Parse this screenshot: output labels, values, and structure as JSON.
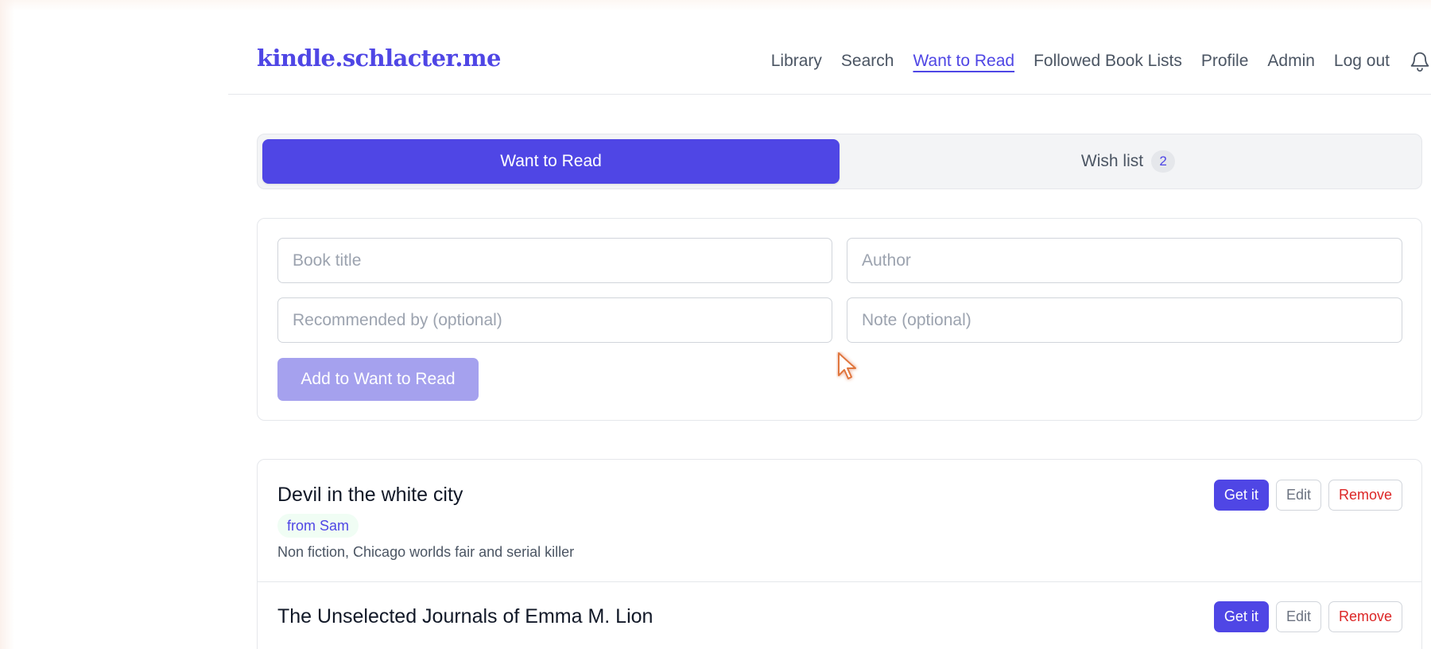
{
  "header": {
    "brand": "kindle.schlacter.me",
    "nav": [
      {
        "label": "Library"
      },
      {
        "label": "Search"
      },
      {
        "label": "Want to Read",
        "active": true
      },
      {
        "label": "Followed Book Lists"
      },
      {
        "label": "Profile"
      },
      {
        "label": "Admin"
      },
      {
        "label": "Log out"
      }
    ]
  },
  "tabs": {
    "want_to_read": "Want to Read",
    "wish_list": "Wish list",
    "wish_list_count": "2"
  },
  "form": {
    "title_placeholder": "Book title",
    "author_placeholder": "Author",
    "recommended_placeholder": "Recommended by (optional)",
    "note_placeholder": "Note (optional)",
    "submit_label": "Add to Want to Read"
  },
  "items": [
    {
      "title": "Devil in the white city",
      "recommended": "from Sam",
      "note": "Non fiction, Chicago worlds fair and serial killer"
    },
    {
      "title": "The Unselected Journals of Emma M. Lion"
    }
  ],
  "item_actions": {
    "get": "Get it",
    "edit": "Edit",
    "remove": "Remove"
  },
  "colors": {
    "accent": "#4f46e5",
    "accent_disabled": "#a5a1ee",
    "danger": "#dc2626"
  },
  "icons": {
    "notifications": "bell-icon",
    "pointer": "cursor-arrow-icon"
  }
}
